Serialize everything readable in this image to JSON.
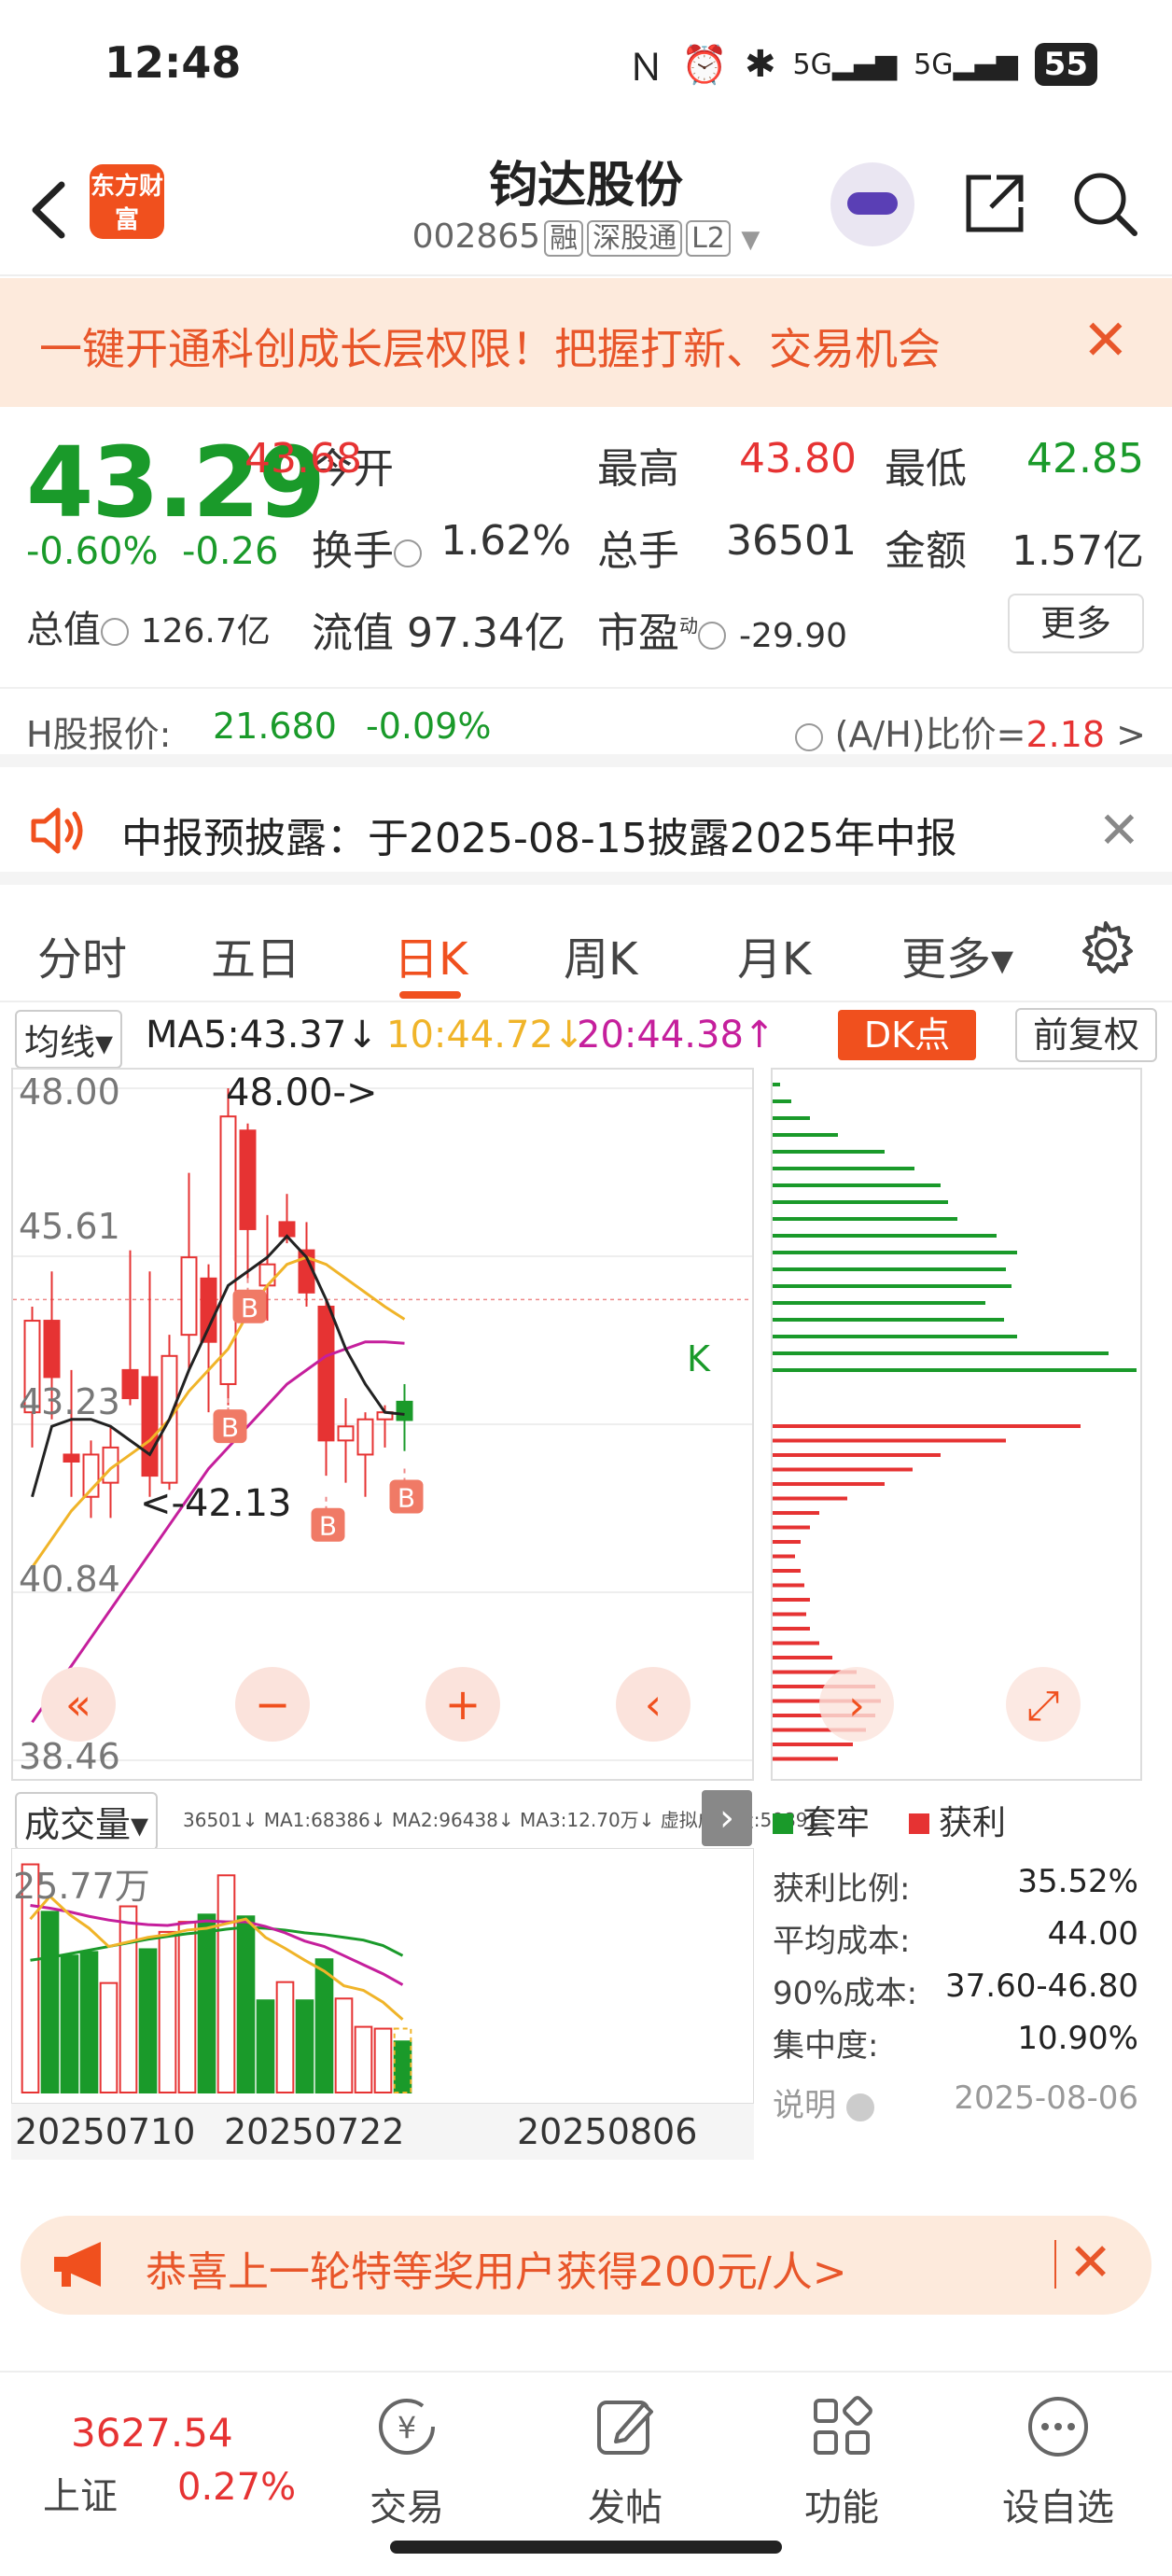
{
  "status": {
    "time": "12:48",
    "battery": "55"
  },
  "header": {
    "logo": "东方财富",
    "name": "钧达股份",
    "code": "002865",
    "tags": [
      "融",
      "深股通",
      "L2"
    ]
  },
  "promo": {
    "text": "一键开通科创成长层权限！把握打新、交易机会",
    "close": "✕"
  },
  "quote": {
    "price": "43.29",
    "change_pct": "-0.60%",
    "change_abs": "-0.26",
    "fields": {
      "open_label": "今开",
      "open": "43.68",
      "high_label": "最高",
      "high": "43.80",
      "low_label": "最低",
      "low": "42.85",
      "turnover_label": "换手",
      "turnover": "1.62%",
      "volume_label": "总手",
      "volume": "36501",
      "amount_label": "金额",
      "amount": "1.57亿",
      "mktcap_label": "总值",
      "mktcap": "126.7亿",
      "float_label": "流值",
      "float": "97.34亿",
      "pe_label": "市盈",
      "pe_sup": "动",
      "pe": "-29.90"
    },
    "more": "更多"
  },
  "hshare": {
    "label": "H股报价:",
    "price": "21.680",
    "chg": "-0.09%",
    "ratio_label": "(A/H)比价=",
    "ratio": "2.18",
    "arrow": ">"
  },
  "notice": {
    "text": "中报预披露：于2025-08-15披露2025年中报",
    "close": "✕"
  },
  "tabs": [
    "分时",
    "五日",
    "日K",
    "周K",
    "月K",
    "更多▾"
  ],
  "active_tab": "日K",
  "ma": {
    "selector": "均线▾",
    "ma5": "MA5:43.37↓",
    "ma10": "10:44.72↓",
    "ma20": "20:44.38↑",
    "dk": "DK点",
    "fq": "前复权"
  },
  "colors": {
    "up": "#e63333",
    "down": "#1a9a2a",
    "ma5": "#222222",
    "ma10": "#f0b429",
    "ma20": "#c51f9c",
    "accent": "#f0501e"
  },
  "kchart": {
    "yticks": [
      "48.00",
      "45.61",
      "43.23",
      "40.84",
      "38.46"
    ],
    "annot_high": "48.00->",
    "annot_low": "<-42.13",
    "k_marker": "K",
    "b_marker": "B"
  },
  "chart_data": {
    "type": "candlestick",
    "ylim": [
      38.46,
      48.0
    ],
    "candles": [
      {
        "o": 43.4,
        "c": 44.7,
        "h": 44.9,
        "l": 42.9
      },
      {
        "o": 44.7,
        "c": 43.9,
        "h": 45.4,
        "l": 43.3
      },
      {
        "o": 42.8,
        "c": 42.7,
        "h": 44.0,
        "l": 42.2
      },
      {
        "o": 42.2,
        "c": 42.8,
        "h": 43.0,
        "l": 41.9
      },
      {
        "o": 42.4,
        "c": 42.9,
        "h": 43.2,
        "l": 41.9
      },
      {
        "o": 44.0,
        "c": 43.6,
        "h": 45.7,
        "l": 43.5
      },
      {
        "o": 43.9,
        "c": 42.5,
        "h": 45.4,
        "l": 42.2
      },
      {
        "o": 42.4,
        "c": 44.2,
        "h": 44.5,
        "l": 42.3
      },
      {
        "o": 44.5,
        "c": 45.6,
        "h": 46.8,
        "l": 44.0
      },
      {
        "o": 45.3,
        "c": 44.4,
        "h": 45.5,
        "l": 43.4
      },
      {
        "o": 43.8,
        "c": 47.6,
        "h": 48.0,
        "l": 43.5
      },
      {
        "o": 47.4,
        "c": 46.0,
        "h": 47.5,
        "l": 45.3
      },
      {
        "o": 45.2,
        "c": 45.5,
        "h": 46.2,
        "l": 44.7
      },
      {
        "o": 46.1,
        "c": 45.9,
        "h": 46.5,
        "l": 45.8
      },
      {
        "o": 45.7,
        "c": 45.1,
        "h": 46.1,
        "l": 44.9
      },
      {
        "o": 44.9,
        "c": 43.0,
        "h": 45.0,
        "l": 42.5
      },
      {
        "o": 43.0,
        "c": 43.2,
        "h": 43.6,
        "l": 42.4
      },
      {
        "o": 42.8,
        "c": 43.3,
        "h": 43.4,
        "l": 42.2
      },
      {
        "o": 43.3,
        "c": 43.4,
        "h": 43.5,
        "l": 42.9
      },
      {
        "o": 43.55,
        "c": 43.29,
        "h": 43.8,
        "l": 42.85
      }
    ],
    "ma5": [
      42.2,
      43.2,
      43.3,
      43.3,
      43.2,
      43.0,
      42.8,
      43.3,
      44.0,
      44.6,
      45.2,
      45.4,
      45.6,
      45.9,
      45.6,
      45.0,
      44.3,
      43.8,
      43.4,
      43.37
    ],
    "ma10": [
      41.2,
      41.6,
      42.0,
      42.3,
      42.6,
      42.8,
      43.0,
      43.3,
      43.7,
      44.0,
      44.3,
      44.8,
      45.2,
      45.5,
      45.6,
      45.5,
      45.3,
      45.1,
      44.9,
      44.72
    ],
    "ma20": [
      39.0,
      39.4,
      39.8,
      40.2,
      40.6,
      41.0,
      41.4,
      41.8,
      42.2,
      42.6,
      42.9,
      43.2,
      43.5,
      43.8,
      44.0,
      44.2,
      44.3,
      44.4,
      44.4,
      44.38
    ],
    "dates": [
      "20250710",
      "20250722",
      "20250806"
    ]
  },
  "volume": {
    "selector": "成交量▾",
    "summary": "36501↓ MA1:68386↓ MA2:96438↓ MA3:12.70万↓ 虚拟成交量:59891",
    "ymax_label": "25.77万",
    "bars": [
      25.0,
      19.8,
      15.0,
      15.4,
      12.0,
      20.4,
      15.7,
      17.6,
      18.7,
      19.5,
      23.8,
      19.3,
      10.1,
      12.1,
      10.1,
      14.6,
      10.3,
      7.2,
      7.0,
      5.6
    ],
    "dir": [
      1,
      0,
      0,
      0,
      1,
      1,
      0,
      1,
      1,
      0,
      1,
      0,
      0,
      1,
      0,
      0,
      1,
      1,
      1,
      0
    ],
    "ma1": [
      19.0,
      21.5,
      19.5,
      18.0,
      16.0,
      16.5,
      17.0,
      17.3,
      17.8,
      18.0,
      18.5,
      19.0,
      17.0,
      15.8,
      14.5,
      13.3,
      11.7,
      11.2,
      9.9,
      8.0
    ],
    "ma2": [
      20.5,
      20.2,
      19.8,
      19.3,
      18.9,
      18.6,
      18.4,
      18.3,
      18.6,
      18.8,
      18.7,
      18.7,
      18.2,
      17.5,
      16.6,
      16.0,
      15.0,
      14.0,
      13.0,
      11.8
    ],
    "ma3": [
      14.5,
      14.8,
      15.2,
      15.6,
      16.0,
      16.4,
      16.8,
      17.1,
      17.4,
      17.6,
      17.9,
      18.1,
      18.0,
      17.8,
      17.5,
      17.3,
      17.0,
      16.7,
      16.1,
      15.0
    ]
  },
  "chips": {
    "legend_trapped": "套牢",
    "legend_profit": "获利",
    "stats": [
      {
        "k": "获利比例:",
        "v": "35.52%"
      },
      {
        "k": "平均成本:",
        "v": "44.00"
      },
      {
        "k": "90%成本:",
        "v": "37.60-46.80"
      },
      {
        "k": "集中度:",
        "v": "10.90%"
      }
    ],
    "note_label": "说明",
    "date": "2025-08-06"
  },
  "bottom_banner": {
    "text": "恭喜上一轮特等奖用户获得200元/人>",
    "close": "✕"
  },
  "tabbar": {
    "index_value": "3627.54",
    "index_name": "上证",
    "index_chg": "0.27%",
    "items": [
      "交易",
      "发帖",
      "功能",
      "设自选"
    ]
  }
}
